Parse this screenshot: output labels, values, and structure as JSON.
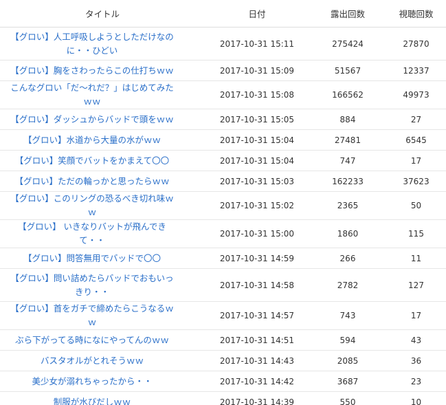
{
  "table": {
    "headers": {
      "title": "タイトル",
      "date": "日付",
      "impressions": "露出回数",
      "views": "視聴回数"
    },
    "rows": [
      {
        "title": "【グロい】人工呼吸しようとしただけなのに・・ひどい",
        "date": "2017-10-31 15:11",
        "impressions": "275424",
        "views": "27870"
      },
      {
        "title": "【グロい】胸をさわったらこの仕打ちｗｗ",
        "date": "2017-10-31 15:09",
        "impressions": "51567",
        "views": "12337"
      },
      {
        "title": "こんなグロい「だ〜れだ？」はじめてみたｗｗ",
        "date": "2017-10-31 15:08",
        "impressions": "166562",
        "views": "49973"
      },
      {
        "title": "【グロい】ダッシュからバッドで頭をｗｗ",
        "date": "2017-10-31 15:05",
        "impressions": "884",
        "views": "27"
      },
      {
        "title": "【グロい】水道から大量の水がｗｗ",
        "date": "2017-10-31 15:04",
        "impressions": "27481",
        "views": "6545"
      },
      {
        "title": "【グロい】笑顔でバットをかまえて〇〇",
        "date": "2017-10-31 15:04",
        "impressions": "747",
        "views": "17"
      },
      {
        "title": "【グロい】ただの輪っかと思ったらｗｗ",
        "date": "2017-10-31 15:03",
        "impressions": "162233",
        "views": "37623"
      },
      {
        "title": "【グロい】このリングの恐るべき切れ味ｗｗ",
        "date": "2017-10-31 15:02",
        "impressions": "2365",
        "views": "50"
      },
      {
        "title": "【グロい】 いきなりバットが飛んできて・・",
        "date": "2017-10-31 15:00",
        "impressions": "1860",
        "views": "115"
      },
      {
        "title": "【グロい】問答無用でバッドで〇〇",
        "date": "2017-10-31 14:59",
        "impressions": "266",
        "views": "11"
      },
      {
        "title": "【グロい】問い詰めたらバッドでおもいっきり・・",
        "date": "2017-10-31 14:58",
        "impressions": "2782",
        "views": "127"
      },
      {
        "title": "【グロい】首をガチで締めたらこうなるｗｗ",
        "date": "2017-10-31 14:57",
        "impressions": "743",
        "views": "17"
      },
      {
        "title": "ぶら下がってる時になにやってんのｗｗ",
        "date": "2017-10-31 14:51",
        "impressions": "594",
        "views": "43"
      },
      {
        "title": "バスタオルがとれそうｗｗ",
        "date": "2017-10-31 14:43",
        "impressions": "2085",
        "views": "36"
      },
      {
        "title": "美少女が溺れちゃったから・・",
        "date": "2017-10-31 14:42",
        "impressions": "3687",
        "views": "23"
      },
      {
        "title": "制服が水びだしｗｗ",
        "date": "2017-10-31 14:39",
        "impressions": "550",
        "views": "10"
      }
    ]
  }
}
